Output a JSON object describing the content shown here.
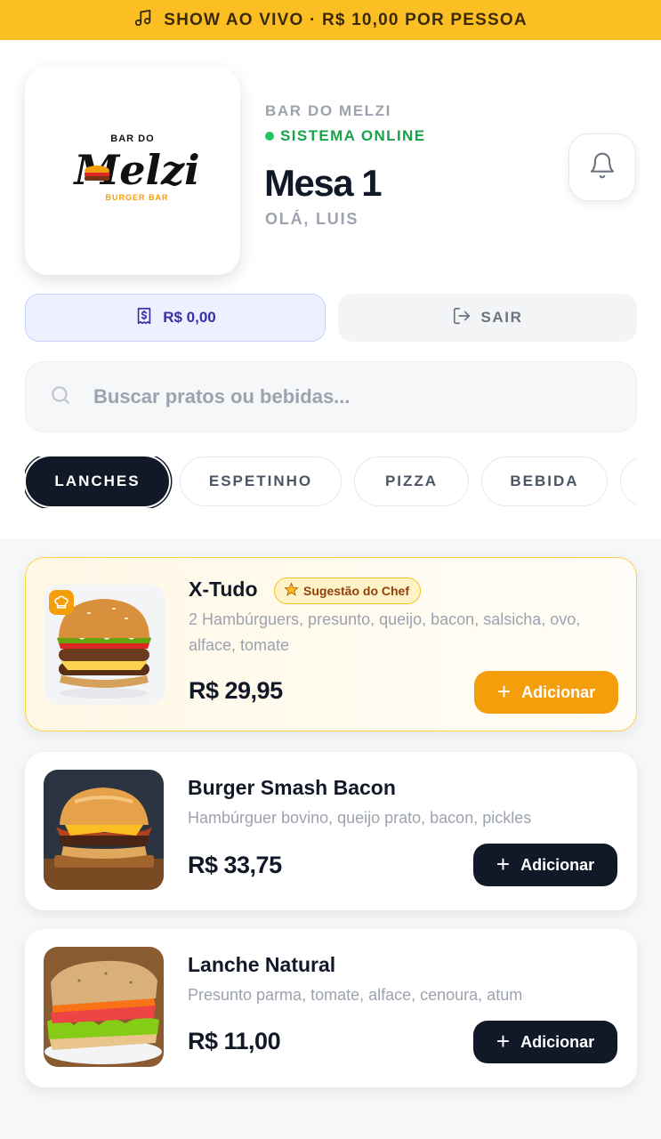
{
  "banner": {
    "text": "SHOW AO VIVO · R$ 10,00 POR PESSOA",
    "icon": "music-note-icon"
  },
  "venue": {
    "logo": {
      "top": "BAR DO",
      "name": "Melzi",
      "sub": "BURGER BAR"
    },
    "name": "BAR DO MELZI",
    "status": "SISTEMA ONLINE",
    "table": "Mesa 1",
    "greeting": "OLÁ, LUIS"
  },
  "actions": {
    "balance": "R$ 0,00",
    "exit": "SAIR"
  },
  "search": {
    "placeholder": "Buscar pratos ou bebidas..."
  },
  "categories": [
    "LANCHES",
    "ESPETINHO",
    "PIZZA",
    "BEBIDA"
  ],
  "active_category": "LANCHES",
  "products": [
    {
      "name": "X-Tudo",
      "badge": "Sugestão do Chef",
      "description": "2 Hambúrguers, presunto, queijo, bacon, salsicha, ovo, alface, tomate",
      "price": "R$ 29,95",
      "button": "Adicionar"
    },
    {
      "name": "Burger Smash Bacon",
      "description": "Hambúrguer bovino, queijo prato, bacon, pickles",
      "price": "R$ 33,75",
      "button": "Adicionar"
    },
    {
      "name": "Lanche Natural",
      "description": "Presunto parma, tomate, alface, cenoura, atum",
      "price": "R$ 11,00",
      "button": "Adicionar"
    }
  ],
  "colors": {
    "banner": "#fbbf24",
    "online": "#16a34a",
    "primary": "#111827",
    "featured_button": "#f59e0b"
  }
}
